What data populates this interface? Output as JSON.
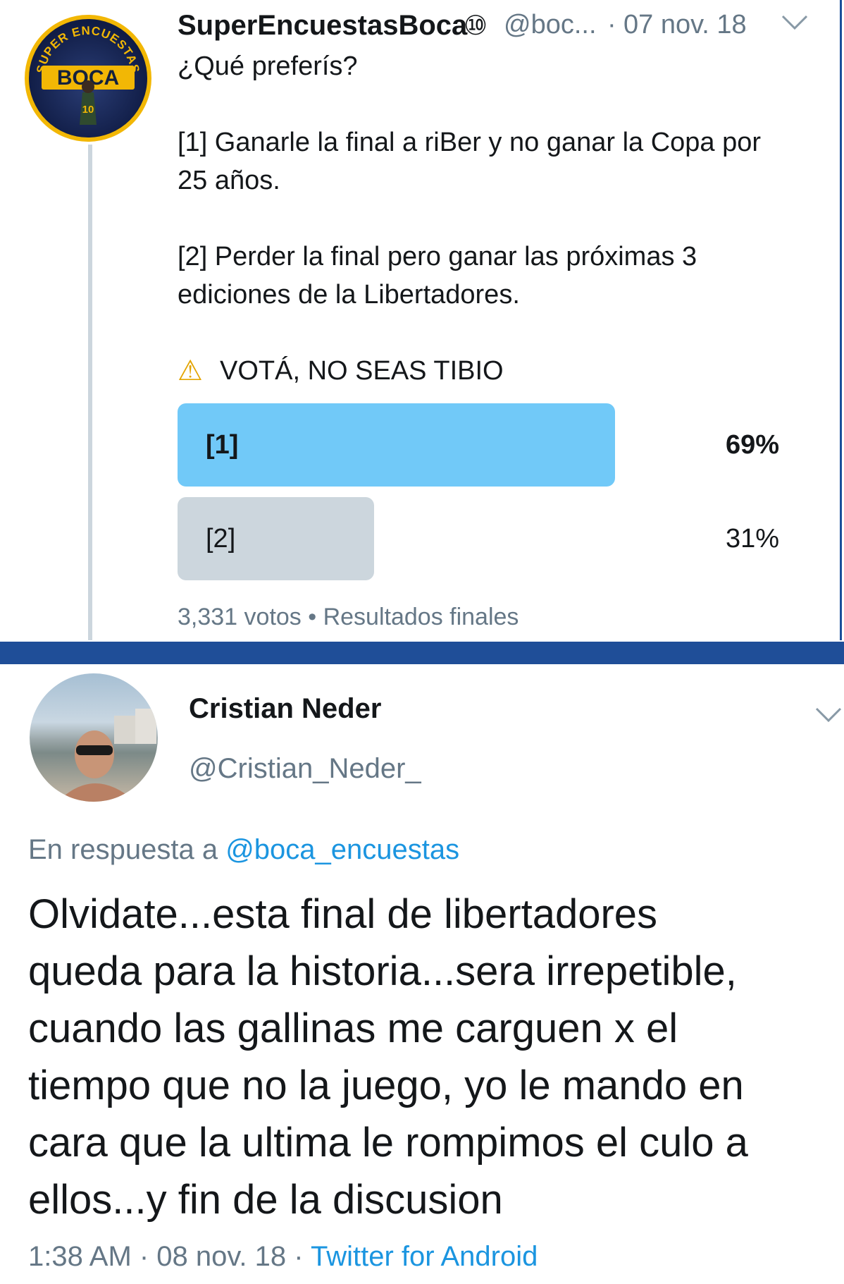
{
  "tweet": {
    "avatar_text": {
      "ring": "SUPER ENCUESTAS",
      "main": "BOCA",
      "number": "10"
    },
    "author_name": "SuperEncuestasBoca",
    "badge": "⑩",
    "handle": "@boc...",
    "dot": "·",
    "date": "07 nov. 18",
    "text_line1": "¿Qué preferís?",
    "option1_line1": "[1] Ganarle la final a riBer y no ganar la Copa por",
    "option1_line2": "25 años.",
    "option2_line1": "[2] Perder la final pero ganar las próximas 3",
    "option2_line2": "ediciones de la Libertadores.",
    "warning_icon": "⚠",
    "warning_text": "VOTÁ, NO SEAS TIBIO",
    "poll": {
      "options": [
        {
          "label": "[1]",
          "percent_text": "69%",
          "percent": 69,
          "winner": true
        },
        {
          "label": "[2]",
          "percent_text": "31%",
          "percent": 31,
          "winner": false
        }
      ],
      "footer": "3,331 votos • Resultados finales"
    }
  },
  "reply": {
    "author_name": "Cristian Neder",
    "handle": "@Cristian_Neder_",
    "in_reply_prefix": "En respuesta a",
    "in_reply_handle": "@boca_encuestas",
    "lines": [
      "Olvidate...esta final de libertadores",
      "queda para la historia...sera irrepetible,",
      "cuando las gallinas me carguen x el",
      "tiempo que no la juego, yo le mando en",
      "cara que la ultima le rompimos el culo a",
      "ellos...y fin de la discusion"
    ],
    "time": "1:38 AM · 08 nov. 18 ·",
    "source": "Twitter for Android"
  },
  "colors": {
    "poll_winner": "#71c9f8",
    "poll_other": "#ccd6dd",
    "link": "#1b95e0",
    "frame": "#1f4e98"
  }
}
